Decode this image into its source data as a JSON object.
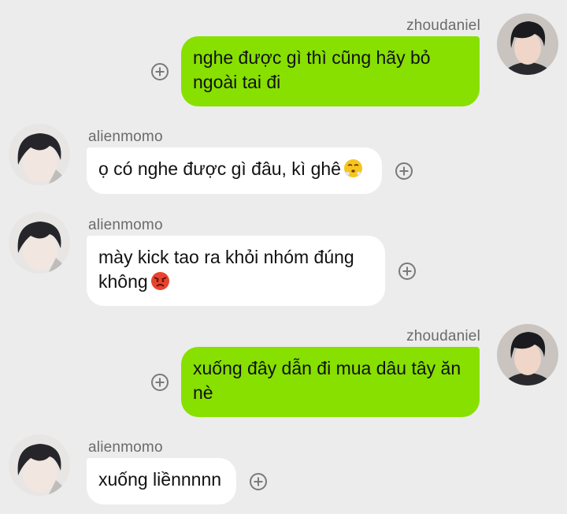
{
  "messages": [
    {
      "sender": "zhoudaniel",
      "text": "nghe được gì thì cũng hãy bỏ ngoài tai đi",
      "emoji": ""
    },
    {
      "sender": "alienmomo",
      "text": "ọ có nghe được gì đâu, kì ghê",
      "emoji": "face-with-steam-emoji"
    },
    {
      "sender": "alienmomo",
      "text": "mày kick tao ra khỏi nhóm đúng không",
      "emoji": "angry-face-emoji"
    },
    {
      "sender": "zhoudaniel",
      "text": "xuống đây dẫn đi mua dâu tây ăn nè",
      "emoji": ""
    },
    {
      "sender": "alienmomo",
      "text": "xuống liềnnnnn",
      "emoji": ""
    }
  ],
  "colors": {
    "background": "#ececec",
    "outgoing_bubble": "#87e000",
    "incoming_bubble": "#ffffff",
    "name_text": "#6b6b6b"
  }
}
